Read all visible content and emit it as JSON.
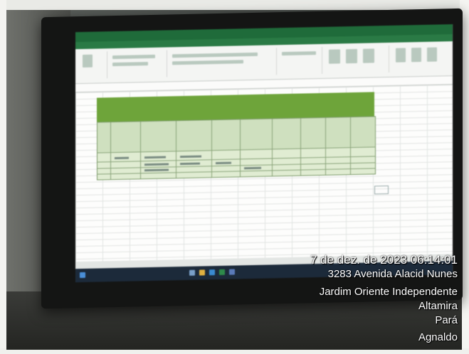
{
  "photo_stamp": {
    "datetime": "7 de dez. de 2023 06:14:01",
    "street": "3283 Avenida Alacid Nunes",
    "district": "Jardim Oriente Independente",
    "city": "Altamira",
    "state": "Pará",
    "user": "Agnaldo"
  },
  "colors": {
    "excel_green": "#1f6b3a",
    "banner_green": "#6ea43a",
    "stamp_text": "#ffffff"
  }
}
